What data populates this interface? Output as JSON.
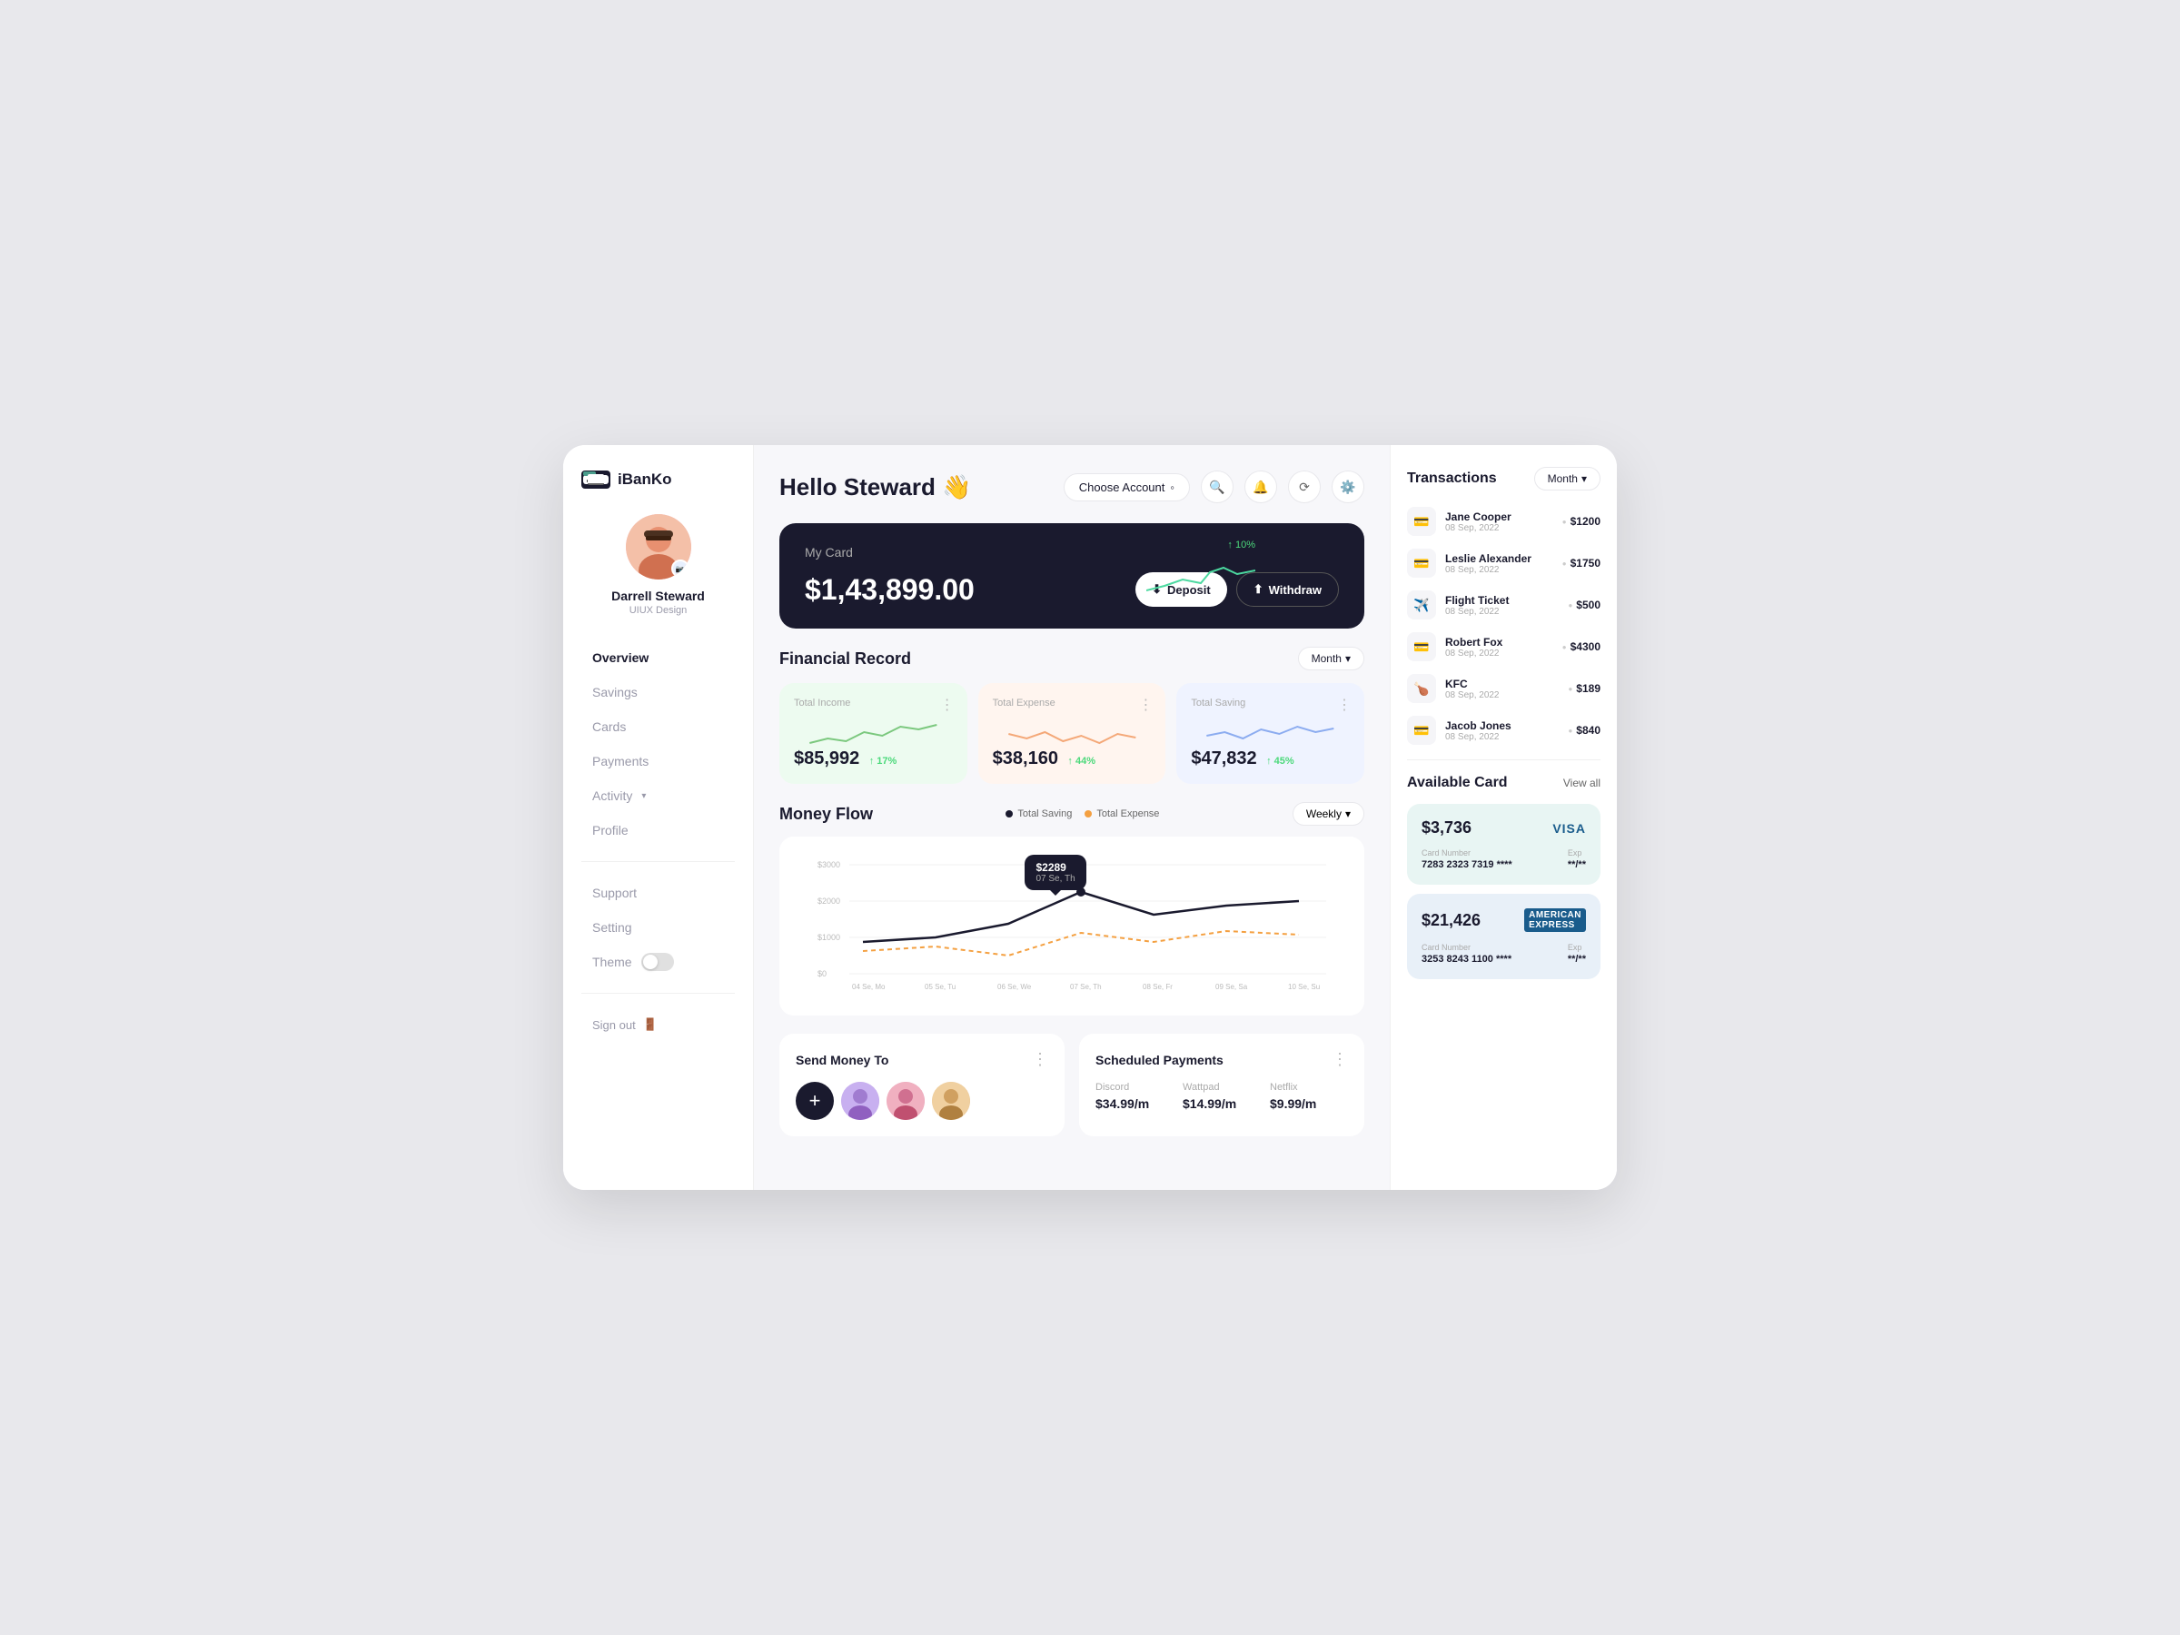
{
  "app": {
    "logo_text": "iBanKo",
    "greeting": "Hello Steward 👋"
  },
  "header": {
    "choose_account_label": "Choose Account",
    "search_icon": "🔍",
    "bell_icon": "🔔",
    "refresh_icon": "🔄",
    "settings_icon": "⚙️"
  },
  "sidebar": {
    "profile_name": "Darrell Steward",
    "profile_role": "UIUX Design",
    "nav_items": [
      {
        "label": "Overview",
        "active": true
      },
      {
        "label": "Savings",
        "active": false
      },
      {
        "label": "Cards",
        "active": false
      },
      {
        "label": "Payments",
        "active": false
      },
      {
        "label": "Activity",
        "active": false,
        "has_dropdown": true
      },
      {
        "label": "Profile",
        "active": false
      }
    ],
    "bottom_items": [
      {
        "label": "Support"
      },
      {
        "label": "Setting"
      }
    ],
    "theme_label": "Theme",
    "signout_label": "Sign out"
  },
  "my_card": {
    "label": "My Card",
    "balance": "$1,43,899.00",
    "trend_label": "↑ 10%",
    "deposit_label": "Deposit",
    "withdraw_label": "Withdraw"
  },
  "financial_record": {
    "title": "Financial Record",
    "month_label": "Month",
    "cards": [
      {
        "label": "Total Income",
        "value": "$85,992",
        "change": "↑ 17%",
        "type": "income"
      },
      {
        "label": "Total Expense",
        "value": "$38,160",
        "change": "↑ 44%",
        "type": "expense"
      },
      {
        "label": "Total Saving",
        "value": "$47,832",
        "change": "↑ 45%",
        "type": "saving"
      }
    ]
  },
  "money_flow": {
    "title": "Money Flow",
    "legend": {
      "saving_label": "Total Saving",
      "expense_label": "Total Expense"
    },
    "weekly_label": "Weekly",
    "tooltip": {
      "amount": "$2289",
      "date": "07 Se, Th"
    },
    "x_labels": [
      "04 Se, Mo",
      "05 Se, Tu",
      "06 Se, We",
      "07 Se, Th",
      "08 Se, Fr",
      "09 Se, Sa",
      "10 Se, Su"
    ],
    "y_labels": [
      "$3000",
      "$2000",
      "$1000",
      "$0"
    ]
  },
  "send_money": {
    "title": "Send Money To",
    "avatars": [
      "person1",
      "person2",
      "person3"
    ]
  },
  "scheduled_payments": {
    "title": "Scheduled Payments",
    "items": [
      {
        "name": "Discord",
        "amount": "$34.99/m"
      },
      {
        "name": "Wattpad",
        "amount": "$14.99/m"
      },
      {
        "name": "Netflix",
        "amount": "$9.99/m"
      }
    ]
  },
  "transactions": {
    "title": "Transactions",
    "month_label": "Month",
    "items": [
      {
        "name": "Jane Cooper",
        "date": "08 Sep, 2022",
        "amount": "$1200"
      },
      {
        "name": "Leslie Alexander",
        "date": "08 Sep, 2022",
        "amount": "$1750"
      },
      {
        "name": "Flight Ticket",
        "date": "08 Sep, 2022",
        "amount": "$500"
      },
      {
        "name": "Robert Fox",
        "date": "08 Sep, 2022",
        "amount": "$4300"
      },
      {
        "name": "KFC",
        "date": "08 Sep, 2022",
        "amount": "$189"
      },
      {
        "name": "Jacob Jones",
        "date": "08 Sep, 2022",
        "amount": "$840"
      }
    ]
  },
  "available_cards": {
    "title": "Available Card",
    "view_all_label": "View all",
    "cards": [
      {
        "balance": "$3,736",
        "brand": "VISA",
        "card_number": "7283 2323 7319 ****",
        "exp": "**/**",
        "number_label": "Card Number",
        "exp_label": "Exp",
        "type": "visa"
      },
      {
        "balance": "$21,426",
        "brand": "AMEX",
        "card_number": "3253 8243 1100 ****",
        "exp": "**/**",
        "number_label": "Card Number",
        "exp_label": "Exp",
        "type": "amex"
      }
    ]
  }
}
